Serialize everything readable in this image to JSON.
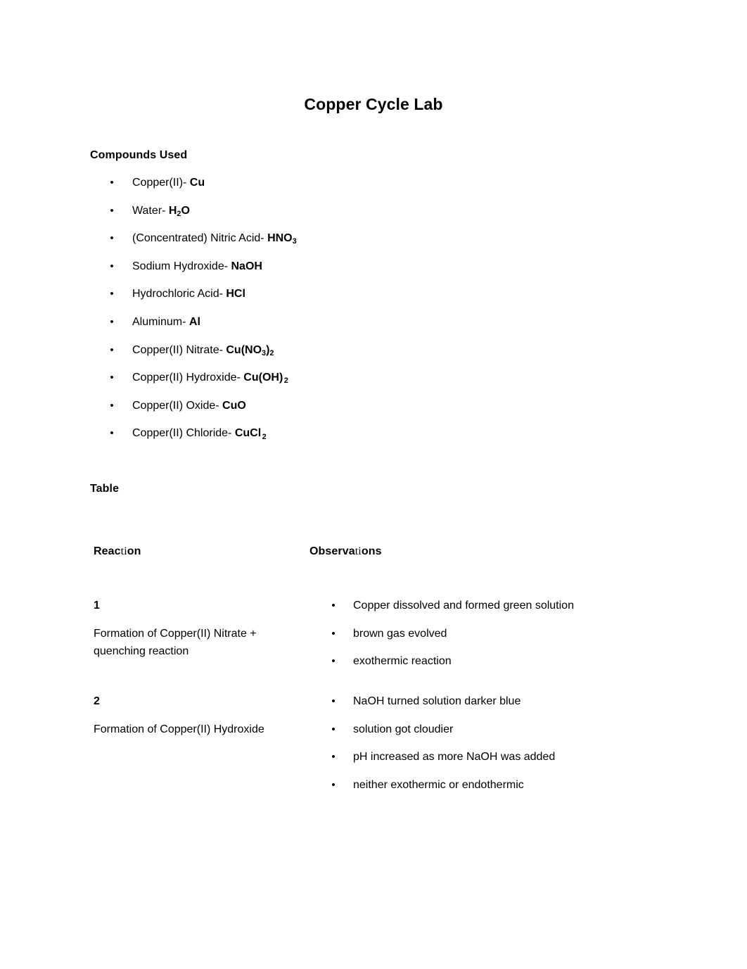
{
  "document": {
    "title": "Copper Cycle Lab"
  },
  "sections": {
    "compounds_heading": "Compounds Used",
    "table_heading": "Table"
  },
  "compounds": [
    {
      "name": "Copper(II)- ",
      "formula_main": "Cu",
      "sub1": "",
      "formula_tail": "",
      "sub2": ""
    },
    {
      "name": "Water- ",
      "formula_main": "H",
      "sub1": "2",
      "formula_tail": "O",
      "sub2": ""
    },
    {
      "name": "(Concentrated) Nitric Acid- ",
      "formula_main": "HNO",
      "sub1": "3",
      "formula_tail": "",
      "sub2": ""
    },
    {
      "name": "Sodium Hydroxide- ",
      "formula_main": "NaOH",
      "sub1": "",
      "formula_tail": "",
      "sub2": ""
    },
    {
      "name": "Hydrochloric Acid- ",
      "formula_main": "HCl",
      "sub1": "",
      "formula_tail": "",
      "sub2": ""
    },
    {
      "name": "Aluminum- ",
      "formula_main": "Al",
      "sub1": "",
      "formula_tail": "",
      "sub2": ""
    },
    {
      "name": "Copper(II) Nitrate- ",
      "formula_main": "Cu(NO",
      "sub1": "3",
      "formula_tail": ")",
      "sub2": "2"
    },
    {
      "name": "Copper(II) Hydroxide- ",
      "formula_main": "Cu(OH)",
      "sub1": "",
      "formula_tail": "",
      "sub2": "2"
    },
    {
      "name": "Copper(II) Oxide- ",
      "formula_main": "CuO",
      "sub1": "",
      "formula_tail": "",
      "sub2": ""
    },
    {
      "name": "Copper(II) Chloride- ",
      "formula_main": "CuCl",
      "sub1": "",
      "formula_tail": "",
      "sub2": "2"
    }
  ],
  "bullet_glyph": "•",
  "table": {
    "headers": {
      "reaction_pre": "Reac",
      "reaction_ti": "ti",
      "reaction_post": "on",
      "observations_pre": "Observa",
      "observations_ti": "ti",
      "observations_post": "ons"
    },
    "rows": [
      {
        "number": "1",
        "description": "Formation of Copper(II) Nitrate + quenching reaction",
        "observations": [
          "Copper dissolved and formed green solution",
          "brown gas evolved",
          "exothermic reaction"
        ]
      },
      {
        "number": "2",
        "description": "Formation of Copper(II) Hydroxide",
        "observations": [
          "NaOH turned solution darker blue",
          "solution got cloudier",
          "pH increased as more NaOH was added",
          "neither exothermic or endothermic"
        ]
      }
    ]
  }
}
